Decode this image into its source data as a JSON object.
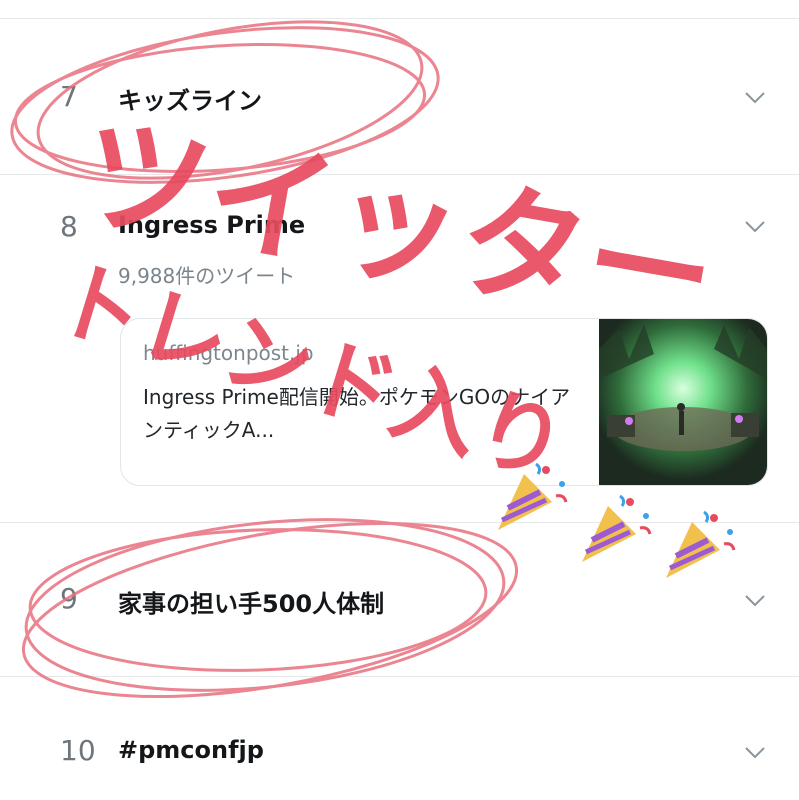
{
  "trends": [
    {
      "rank": "7",
      "topic": "キッズライン"
    },
    {
      "rank": "8",
      "topic": "Ingress Prime",
      "count": "9,988件のツイート",
      "card": {
        "domain": "huffingtonpost.jp",
        "title": "Ingress Prime配信開始。ポケモンGOのナイアンティックA..."
      }
    },
    {
      "rank": "9",
      "topic": "家事の担い手500人体制"
    },
    {
      "rank": "10",
      "topic": "#pmconfjp"
    }
  ],
  "annotation": {
    "line1": "ツイッター",
    "line2": "トレンド入り",
    "color": "#e84a5f",
    "icons": [
      "party-popper-icon",
      "party-popper-icon",
      "party-popper-icon"
    ]
  }
}
